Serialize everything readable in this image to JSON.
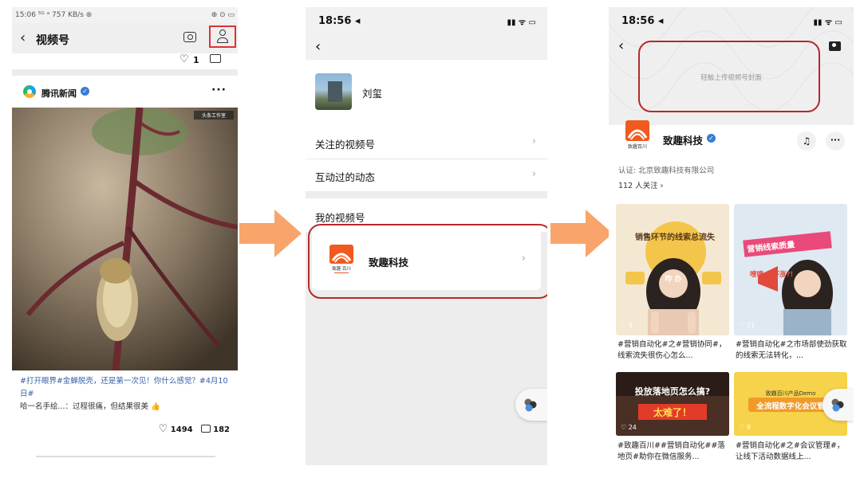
{
  "panel1": {
    "status_text": "15:06 ⁵ᴳ ᵃ 757 KB/s ⊛",
    "status_right": "⊕ ⊙ ▭",
    "title": "视频号",
    "likes_top": "1",
    "account_name": "腾讯新闻",
    "corner_tag": "头条工作室",
    "post_hashtags": "#打开眼界#金蝉脱壳，还是第一次见！你什么感觉？#4月10日#",
    "post_line2": "哈一名手绘...：过程很痛，但结果很美",
    "likes": "1494",
    "comments": "182"
  },
  "panel2": {
    "time": "18:56 ◂",
    "status_icons": "▮▮ ᯤ ▭",
    "username": "刘玺",
    "menu": [
      {
        "label": "关注的视频号"
      },
      {
        "label": "互动过的动态"
      }
    ],
    "my_channel_label": "我的视频号",
    "channel_name": "致趣科技"
  },
  "panel3": {
    "time": "18:56 ◂",
    "status_icons": "▮▮ ᯤ ▭",
    "cover_hint": "轻触上传视频号封面",
    "channel_name": "致趣科技",
    "logo_caption": "致趣百川",
    "certification": "认证: 北京致趣科技有限公司",
    "followers": "112 人关注 ›",
    "videos": [
      {
        "caption": "#营销自动化#之#营销协同#，线索流失很伤心怎么...",
        "likes": "9",
        "overlay": "销售环节的线索总流失",
        "overlay2": "咋 办"
      },
      {
        "caption": "#营销自动化#之市场部使劲获取的线索无法转化，...",
        "likes": "21",
        "overlay": "营销线索质量",
        "overlay2": "嗖嗖 方不涨?!"
      },
      {
        "caption": "#致趣百川##营销自动化##落地页#助你在微信服务...",
        "likes": "24",
        "overlay": "投放落地页怎么搞?",
        "overlay2": "太难了！"
      },
      {
        "caption": "#营销自动化#之#会议管理#，让线下活动数据线上...",
        "likes": "9",
        "overlay": "致趣百川产品Demo",
        "overlay2": "全流程数字化会议管"
      }
    ]
  },
  "colors": {
    "highlight_red": "#b52a2a",
    "arrow_orange": "#f8a46a",
    "brand_orange": "#f05a1e",
    "link_blue": "#3660a8"
  }
}
